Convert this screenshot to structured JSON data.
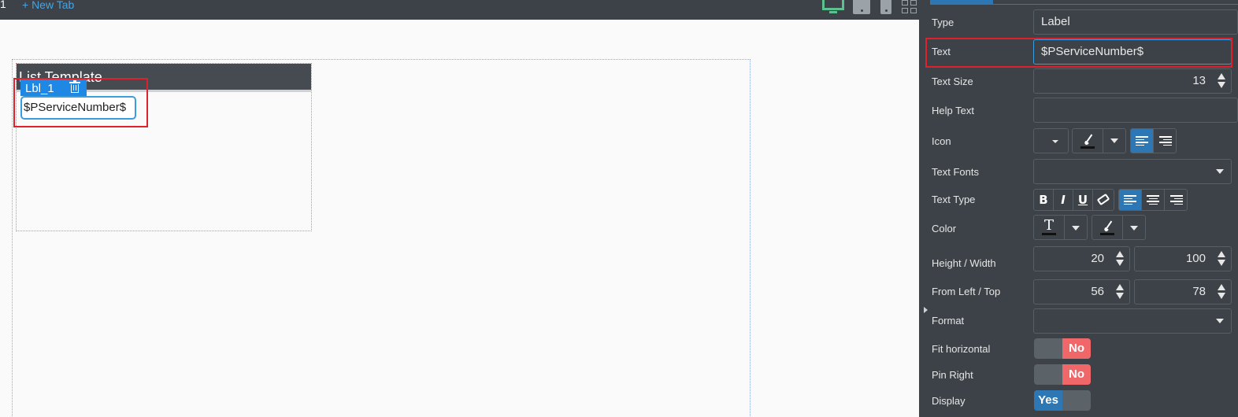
{
  "topbar": {
    "tab_fragment": "1",
    "new_tab_label": "+ New Tab",
    "device_icons": [
      "monitor-icon",
      "tablet-icon",
      "phone-icon",
      "grid-icon"
    ],
    "active_device_color": "#5cc18e"
  },
  "canvas": {
    "list_template_title": "List Template",
    "selected_label_name": "Lbl_1",
    "selected_label_text": "$PServiceNumber$",
    "selection_color": "#1f88e5",
    "highlight_color": "#e0202a"
  },
  "panel": {
    "type": {
      "label": "Type",
      "value": "Label"
    },
    "text": {
      "label": "Text",
      "value": "$PServiceNumber$"
    },
    "text_size": {
      "label": "Text Size",
      "value": "13"
    },
    "help_text": {
      "label": "Help Text",
      "value": ""
    },
    "icon": {
      "label": "Icon"
    },
    "text_fonts": {
      "label": "Text Fonts",
      "value": ""
    },
    "text_type": {
      "label": "Text Type",
      "styles": [
        "B",
        "I",
        "U"
      ]
    },
    "color": {
      "label": "Color"
    },
    "height_width": {
      "label": "Height / Width",
      "height": "20",
      "width": "100"
    },
    "from_left_top": {
      "label": "From Left / Top",
      "left": "56",
      "top": "78"
    },
    "format": {
      "label": "Format",
      "value": ""
    },
    "fit_horizontal": {
      "label": "Fit horizontal",
      "value": "No"
    },
    "pin_right": {
      "label": "Pin Right",
      "value": "No"
    },
    "display": {
      "label": "Display",
      "value": "Yes"
    },
    "accent_color": "#2c77b4",
    "toggle_no_color": "#f0676a"
  }
}
